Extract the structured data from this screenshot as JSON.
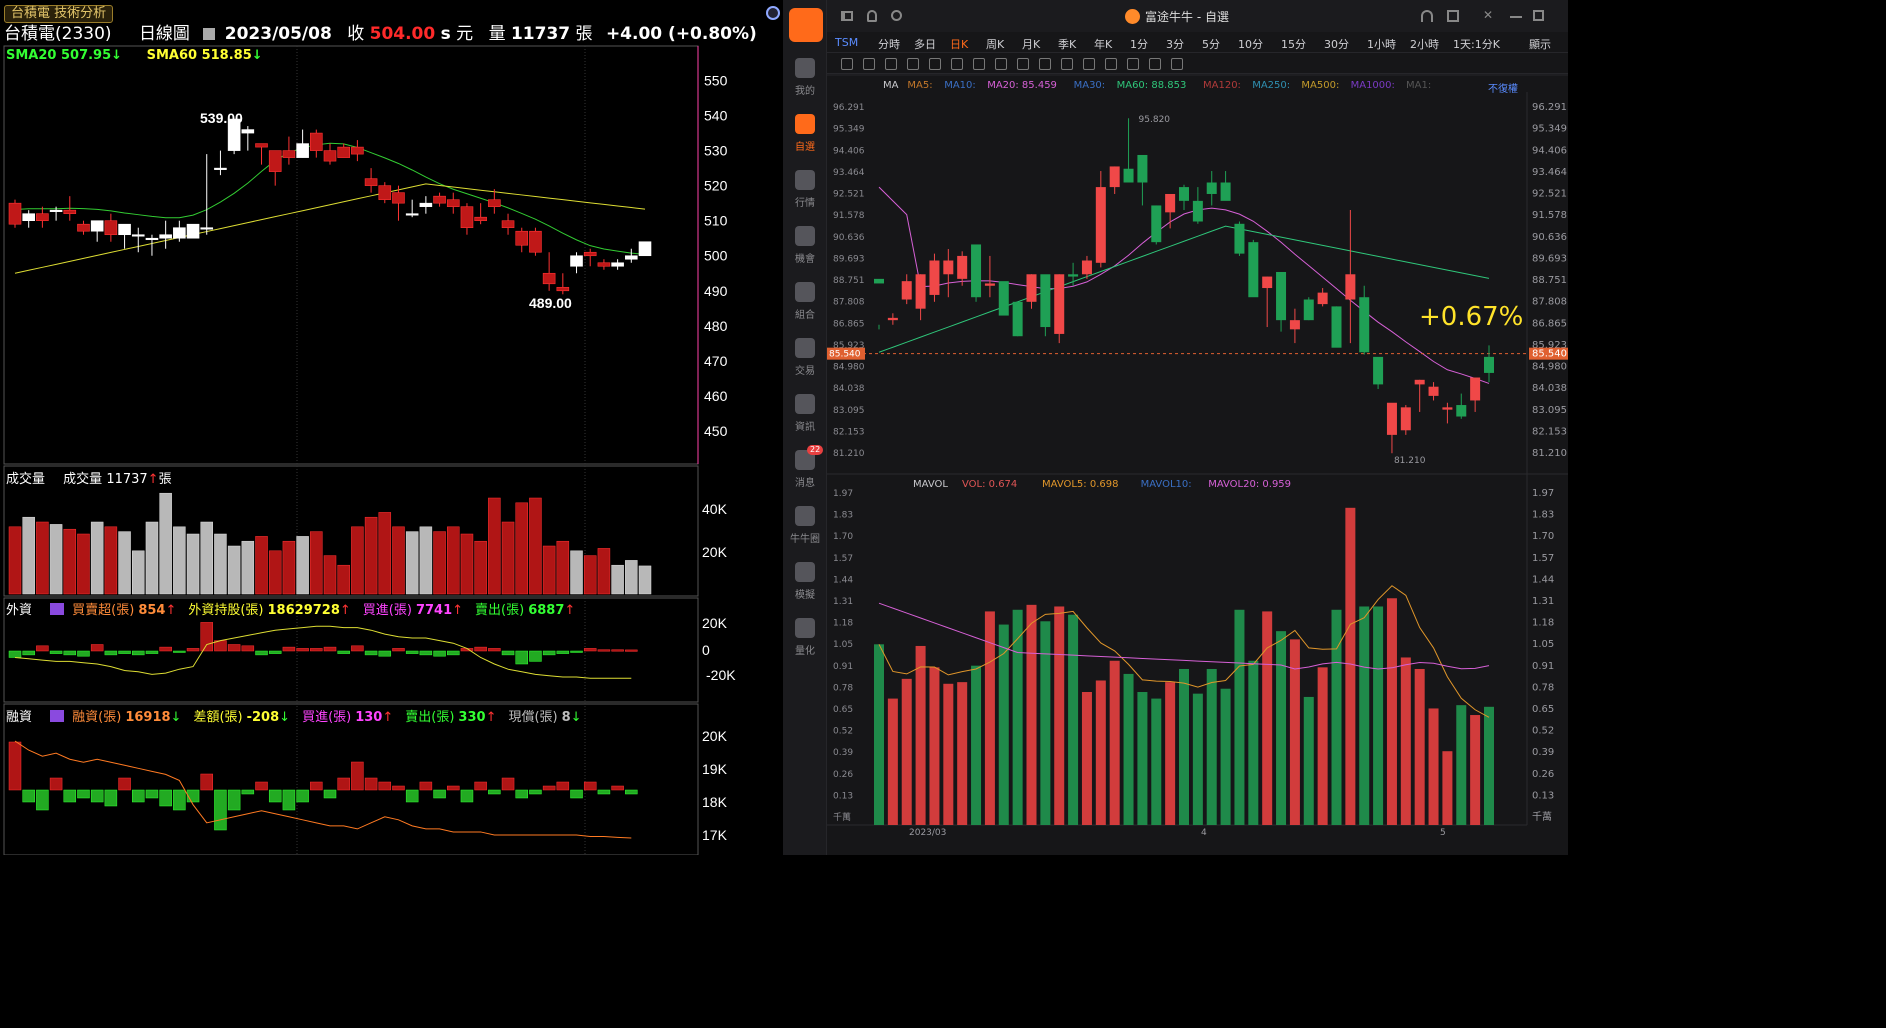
{
  "left": {
    "tab_label": "台積電 技術分析",
    "header": {
      "stock": "台積電(2330)",
      "period": "日線圖",
      "date": "2023/05/08",
      "close_label": "收",
      "close_value": "504.00",
      "s_label": "s",
      "unit_yuan": "元",
      "vol_label": "量",
      "vol_value": "11737",
      "vol_unit": "張",
      "change": "+4.00 (+0.80%)"
    },
    "sma20": {
      "label": "SMA20",
      "value": "507.95",
      "arrow": "↓"
    },
    "sma60": {
      "label": "SMA60",
      "value": "518.85",
      "arrow": "↓"
    },
    "price_axis": [
      "550",
      "540",
      "530",
      "520",
      "510",
      "500",
      "490",
      "480",
      "470",
      "460",
      "450"
    ],
    "high_label": "539.00",
    "low_label": "489.00",
    "volume_panel": {
      "title": "成交量",
      "label": "成交量",
      "value": "11737",
      "arrow": "↑",
      "unit": "張",
      "ticks": [
        "40K",
        "20K"
      ]
    },
    "foreign_panel": {
      "title": "外資",
      "items": [
        {
          "label": "買賣超(張)",
          "value": "854",
          "arrow": "↑",
          "color": "#ff8c3a"
        },
        {
          "label": "外資持股(張)",
          "value": "18629728",
          "arrow": "↑",
          "color": "#ffff33"
        },
        {
          "label": "買進(張)",
          "value": "7741",
          "arrow": "↑",
          "color": "#ff44ff"
        },
        {
          "label": "賣出(張)",
          "value": "6887",
          "arrow": "↑",
          "color": "#33ff33"
        }
      ],
      "ticks": [
        "20K",
        "0",
        "-20K"
      ]
    },
    "margin_panel": {
      "title": "融資",
      "items": [
        {
          "label": "融資(張)",
          "value": "16918",
          "arrow": "↓",
          "color": "#ff8c3a"
        },
        {
          "label": "差額(張)",
          "value": "-208",
          "arrow": "↓",
          "color": "#ffff33"
        },
        {
          "label": "買進(張)",
          "value": "130",
          "arrow": "↑",
          "color": "#ff44ff"
        },
        {
          "label": "賣出(張)",
          "value": "330",
          "arrow": "↑",
          "color": "#33ff33"
        },
        {
          "label": "現償(張)",
          "value": "8",
          "arrow": "↓",
          "color": "#bbbbbb"
        }
      ],
      "ticks": [
        "20K",
        "19K",
        "18K",
        "17K"
      ]
    },
    "candles": [
      [
        515,
        516,
        508,
        509
      ],
      [
        510,
        513,
        508,
        512
      ],
      [
        512,
        514,
        508,
        510
      ],
      [
        513,
        514,
        510,
        513
      ],
      [
        513,
        517,
        510,
        512
      ],
      [
        509,
        510,
        506,
        507
      ],
      [
        507,
        510,
        504,
        510
      ],
      [
        510,
        512,
        504,
        506
      ],
      [
        506,
        509,
        502,
        509
      ],
      [
        506,
        508,
        501,
        506
      ],
      [
        505,
        506,
        500,
        505
      ],
      [
        505,
        510,
        502,
        506
      ],
      [
        505,
        510,
        504,
        508
      ],
      [
        505,
        509,
        505,
        509
      ],
      [
        508,
        529,
        506,
        508
      ],
      [
        525,
        530,
        523,
        525
      ],
      [
        530,
        538,
        529,
        539
      ],
      [
        535,
        537,
        530,
        536
      ],
      [
        532,
        531,
        526,
        531
      ],
      [
        530,
        525,
        520,
        524
      ],
      [
        530,
        534,
        526,
        528
      ],
      [
        528,
        536,
        528,
        532
      ],
      [
        535,
        536,
        528,
        530
      ],
      [
        530,
        532,
        526,
        527
      ],
      [
        531,
        532,
        528,
        528
      ],
      [
        531,
        533,
        527,
        529
      ],
      [
        522,
        525,
        518,
        520
      ],
      [
        520,
        521,
        515,
        516
      ],
      [
        518,
        520,
        510,
        515
      ],
      [
        512,
        516,
        511,
        512
      ],
      [
        514,
        517,
        512,
        515
      ],
      [
        517,
        518,
        514,
        515
      ],
      [
        516,
        518,
        512,
        514
      ],
      [
        514,
        515,
        506,
        508
      ],
      [
        511,
        515,
        509,
        510
      ],
      [
        516,
        519,
        512,
        514
      ],
      [
        510,
        512,
        506,
        508
      ],
      [
        507,
        508,
        501,
        503
      ],
      [
        507,
        508,
        500,
        501
      ],
      [
        495,
        501,
        490,
        492
      ],
      [
        491,
        495,
        489,
        490
      ],
      [
        497,
        501,
        495,
        500
      ],
      [
        501,
        502,
        497,
        500
      ],
      [
        498,
        499,
        496,
        497
      ],
      [
        497,
        499,
        496,
        498
      ],
      [
        499,
        502,
        498,
        500
      ],
      [
        500,
        504,
        500,
        504
      ]
    ],
    "volume": [
      28,
      32,
      30,
      29,
      27,
      25,
      30,
      28,
      26,
      18,
      30,
      42,
      28,
      25,
      30,
      25,
      20,
      22,
      24,
      18,
      22,
      24,
      26,
      16,
      12,
      28,
      32,
      34,
      28,
      26,
      28,
      26,
      28,
      25,
      22,
      40,
      30,
      38,
      40,
      20,
      22,
      18,
      16,
      19,
      12,
      14,
      11.7
    ],
    "foreign_bars": [
      -5,
      -3,
      4,
      -2,
      -3,
      -4,
      5,
      -3,
      -2,
      -3,
      -2,
      3,
      -1,
      2,
      22,
      8,
      5,
      4,
      -3,
      -2,
      3,
      2,
      2,
      3,
      -2,
      4,
      -3,
      -4,
      2,
      -2,
      -3,
      -4,
      -3,
      2,
      3,
      2,
      -3,
      -10,
      -8,
      -3,
      -2,
      -1,
      2,
      1,
      1,
      0.85
    ],
    "foreign_line": [
      -5,
      -6,
      -7,
      -8,
      -8,
      -9,
      -10,
      -12,
      -15,
      -16,
      -18,
      -17,
      -14,
      -12,
      5,
      8,
      10,
      12,
      14,
      16,
      17,
      18,
      19,
      19,
      18,
      18,
      16,
      13,
      11,
      10,
      10,
      8,
      6,
      2,
      -5,
      -10,
      -14,
      -16,
      -18,
      -19,
      -20,
      -20,
      -21,
      -21,
      -21,
      -21
    ],
    "margin_bars": [
      1.2,
      -0.3,
      -0.5,
      0.3,
      -0.3,
      -0.2,
      -0.3,
      -0.4,
      0.3,
      -0.3,
      -0.2,
      -0.4,
      -0.5,
      -0.3,
      0.4,
      -1.0,
      -0.5,
      -0.1,
      0.2,
      -0.3,
      -0.5,
      -0.3,
      0.2,
      -0.2,
      0.3,
      0.7,
      0.3,
      0.2,
      0.1,
      -0.3,
      0.2,
      -0.2,
      0.1,
      -0.3,
      0.2,
      -0.1,
      0.3,
      -0.2,
      -0.1,
      0.1,
      0.2,
      -0.2,
      0.2,
      -0.1,
      0.1,
      -0.1
    ],
    "margin_line": [
      20.1,
      19.8,
      19.6,
      19.7,
      19.5,
      19.4,
      19.5,
      19.4,
      19.3,
      19.2,
      19.1,
      19.0,
      18.8,
      18.0,
      17.4,
      17.5,
      17.6,
      17.7,
      17.8,
      17.7,
      17.6,
      17.5,
      17.4,
      17.3,
      17.3,
      17.2,
      17.4,
      17.6,
      17.5,
      17.3,
      17.2,
      17.2,
      17.1,
      17.1,
      17.1,
      17.0,
      17.0,
      17.0,
      17.0,
      17.0,
      17.0,
      17.0,
      16.95,
      16.95,
      16.92,
      16.9
    ]
  },
  "right": {
    "title": "富途牛牛 - 自選",
    "sidebar": [
      {
        "label": "我的",
        "active": false
      },
      {
        "label": "自選",
        "active": true
      },
      {
        "label": "行情",
        "active": false
      },
      {
        "label": "機會",
        "active": false
      },
      {
        "label": "組合",
        "active": false
      },
      {
        "label": "交易",
        "active": false
      },
      {
        "label": "資訊",
        "active": false
      },
      {
        "label": "消息",
        "active": false
      },
      {
        "label": "牛牛圈",
        "active": false
      },
      {
        "label": "模擬",
        "active": false
      },
      {
        "label": "量化",
        "active": false
      }
    ],
    "badge": "22",
    "periods": [
      "TSM",
      "分時",
      "多日",
      "日K",
      "周K",
      "月K",
      "季K",
      "年K",
      "1分",
      "3分",
      "5分",
      "10分",
      "15分",
      "30分",
      "1小時",
      "2小時",
      "1天:1分K",
      "顯示"
    ],
    "active_period": "日K",
    "ma_legend": [
      {
        "label": "MA",
        "color": "#c8c8cc"
      },
      {
        "label": "MA5:",
        "color": "#c2772a"
      },
      {
        "label": "MA10:",
        "color": "#3a6fc4"
      },
      {
        "label": "MA20: 85.459",
        "color": "#d660d6"
      },
      {
        "label": "MA30:",
        "color": "#3a6fc4"
      },
      {
        "label": "MA60: 88.853",
        "color": "#2fc67a"
      },
      {
        "label": "MA120:",
        "color": "#b03a3a"
      },
      {
        "label": "MA250:",
        "color": "#2f8fb0"
      },
      {
        "label": "MA500:",
        "color": "#c29a2a"
      },
      {
        "label": "MA1000:",
        "color": "#7a3ac4"
      },
      {
        "label": "MA1:",
        "color": "#555"
      }
    ],
    "adjust_label": "不復權",
    "price_ticks": [
      "96.291",
      "95.349",
      "94.406",
      "93.464",
      "92.521",
      "91.578",
      "90.636",
      "89.693",
      "88.751",
      "87.808",
      "86.865",
      "85.923",
      "84.980",
      "84.038",
      "83.095",
      "82.153",
      "81.210"
    ],
    "last_price": "85.540",
    "change_pct": "+0.67%",
    "high_label": "95.820",
    "low_label": "81.210",
    "vol_legend": [
      {
        "label": "MAVOL",
        "color": "#c8c8cc"
      },
      {
        "label": "VOL: 0.674",
        "color": "#e05555"
      },
      {
        "label": "MAVOL5: 0.698",
        "color": "#e0962a"
      },
      {
        "label": "MAVOL10:",
        "color": "#3a6fc4"
      },
      {
        "label": "MAVOL20: 0.959",
        "color": "#d660d6"
      }
    ],
    "vol_ticks": [
      "1.97",
      "1.83",
      "1.70",
      "1.57",
      "1.44",
      "1.31",
      "1.18",
      "1.05",
      "0.91",
      "0.78",
      "0.65",
      "0.52",
      "0.39",
      "0.26",
      "0.13"
    ],
    "vol_unit": "千萬",
    "x_ticks": [
      "2023/03",
      "4",
      "5"
    ],
    "candles": [
      [
        88.8,
        86.8,
        86.6,
        88.6
      ],
      [
        87.0,
        87.3,
        86.8,
        87.1
      ],
      [
        87.9,
        89.0,
        87.7,
        88.7
      ],
      [
        87.5,
        89.0,
        87.0,
        89.0
      ],
      [
        88.1,
        89.9,
        87.8,
        89.6
      ],
      [
        89.0,
        90.1,
        88.0,
        89.6
      ],
      [
        88.8,
        90.0,
        88.5,
        89.8
      ],
      [
        90.3,
        89.9,
        87.8,
        88.0
      ],
      [
        88.5,
        89.8,
        88.0,
        88.6
      ],
      [
        88.7,
        88.6,
        87.6,
        87.2
      ],
      [
        87.8,
        87.0,
        86.3,
        86.3
      ],
      [
        87.8,
        89.0,
        87.5,
        89.0
      ],
      [
        89.0,
        88.5,
        86.3,
        86.7
      ],
      [
        86.4,
        89.0,
        86.0,
        89.0
      ],
      [
        89.0,
        89.5,
        88.5,
        88.9
      ],
      [
        89.0,
        89.8,
        88.8,
        89.6
      ],
      [
        89.5,
        93.5,
        89.3,
        92.8
      ],
      [
        92.8,
        93.7,
        92.5,
        93.7
      ],
      [
        93.6,
        95.8,
        93.2,
        93.0
      ],
      [
        94.2,
        93.5,
        92.0,
        93.0
      ],
      [
        92.0,
        92.0,
        90.3,
        90.4
      ],
      [
        91.7,
        92.4,
        91.0,
        92.5
      ],
      [
        92.8,
        92.9,
        91.8,
        92.2
      ],
      [
        92.2,
        92.8,
        91.2,
        91.3
      ],
      [
        93.0,
        93.5,
        92.0,
        92.5
      ],
      [
        93.0,
        93.5,
        92.3,
        92.2
      ],
      [
        91.2,
        91.3,
        89.8,
        89.9
      ],
      [
        90.4,
        90.5,
        88.2,
        88.0
      ],
      [
        88.4,
        88.9,
        86.7,
        88.9
      ],
      [
        89.1,
        88.9,
        86.5,
        87.0
      ],
      [
        86.6,
        87.5,
        86.0,
        87.0
      ],
      [
        87.9,
        88.0,
        87.0,
        87.0
      ],
      [
        87.7,
        88.4,
        87.6,
        88.2
      ],
      [
        87.6,
        87.6,
        86.2,
        85.8
      ],
      [
        87.9,
        91.8,
        86.0,
        89.0
      ],
      [
        88.0,
        88.5,
        85.5,
        85.6
      ],
      [
        85.4,
        85.3,
        84.0,
        84.2
      ],
      [
        82.0,
        83.0,
        81.2,
        83.4
      ],
      [
        82.2,
        83.3,
        82.0,
        83.2
      ],
      [
        84.2,
        84.4,
        83.0,
        84.4
      ],
      [
        83.7,
        84.3,
        83.5,
        84.1
      ],
      [
        83.1,
        83.4,
        82.5,
        83.2
      ],
      [
        83.3,
        83.8,
        82.7,
        82.8
      ],
      [
        83.5,
        84.3,
        83.0,
        84.5
      ],
      [
        85.4,
        85.9,
        84.3,
        84.7
      ]
    ],
    "volume": [
      1.05,
      0.72,
      0.84,
      1.04,
      0.91,
      0.81,
      0.82,
      0.92,
      1.25,
      1.17,
      1.26,
      1.29,
      1.19,
      1.28,
      1.23,
      0.76,
      0.83,
      0.95,
      0.87,
      0.76,
      0.72,
      0.82,
      0.9,
      0.75,
      0.9,
      0.78,
      1.26,
      0.95,
      1.25,
      1.13,
      1.08,
      0.73,
      0.91,
      1.26,
      1.88,
      1.28,
      1.28,
      1.33,
      0.97,
      0.9,
      0.66,
      0.4,
      0.68,
      0.62,
      0.67
    ]
  }
}
